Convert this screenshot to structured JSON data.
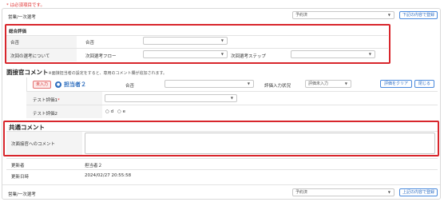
{
  "required_note": "* は必須項目です。",
  "top_row": {
    "label": "営業/一次選考",
    "select_value": "予約済",
    "button": "下記の内容で登録"
  },
  "overall": {
    "title": "総合評価",
    "pass_row_label": "合否",
    "pass_field_label": "合否",
    "next_row_label": "次回の選考について",
    "next_flow_label": "次回選考フロー",
    "next_step_label": "次回選考ステップ"
  },
  "interviewer": {
    "title": "面接官コメント",
    "note": "※面接担当者の設定をすると、専用のコメント欄が追加されます。",
    "badge": "未入力",
    "assignee": "担当者２",
    "pass_label": "合否",
    "input_status_label": "評価入力状況",
    "input_status_value": "評価未入力",
    "clear_button": "評価をクリア",
    "close_button": "閉じる",
    "test1_label": "テスト評価1",
    "test1_required": "*",
    "test2_label": "テスト評価2",
    "radio_d": "d",
    "radio_e": "e"
  },
  "common": {
    "title": "共通コメント",
    "comment_label": "次面接官へのコメント"
  },
  "meta": {
    "updated_by_label": "更新者",
    "updated_by_value": "担当者２",
    "updated_at_label": "更新日時",
    "updated_at_value": "2024/02/27 20:55:58"
  },
  "bottom_row": {
    "label": "営業/一次選考",
    "select_value": "予約済",
    "button": "上記の内容で登録"
  }
}
